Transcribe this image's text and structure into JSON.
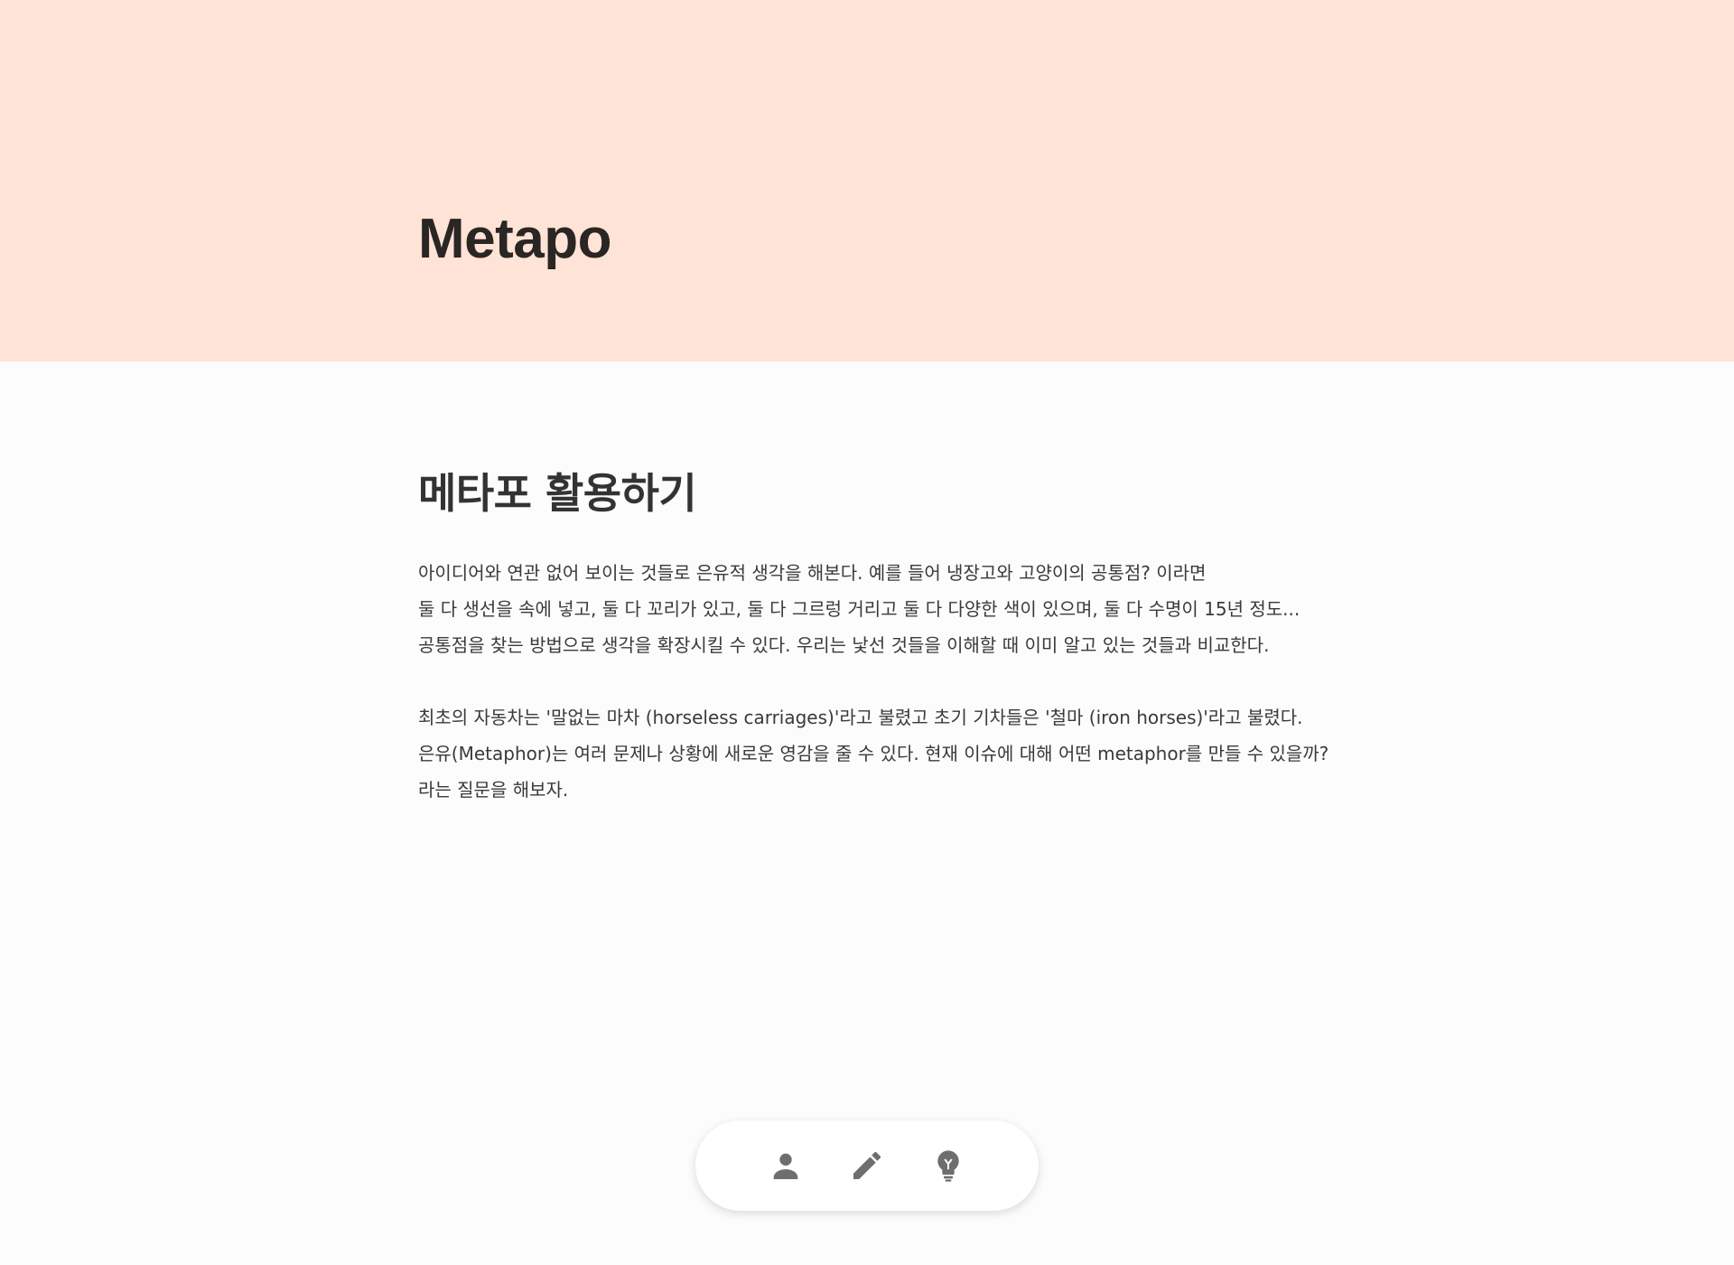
{
  "app": {
    "title": "Metapo"
  },
  "colors": {
    "hero_background": "#ffe3d6",
    "page_background": "#fcfcfc",
    "icon": "#6e6e6e"
  },
  "section": {
    "heading": "메타포 활용하기",
    "paragraphs": [
      {
        "lines": [
          "아이디어와 연관 없어 보이는 것들로 은유적 생각을 해본다. 예를 들어 냉장고와 고양이의 공통점? 이라면",
          "둘 다 생선을 속에 넣고, 둘 다 꼬리가 있고, 둘 다 그르렁 거리고 둘 다 다양한 색이 있으며, 둘 다 수명이 15년 정도...",
          "공통점을 찾는 방법으로 생각을 확장시킬 수 있다. 우리는 낯선 것들을 이해할 때 이미 알고 있는 것들과 비교한다."
        ]
      },
      {
        "lines": [
          "최초의 자동차는 '말없는 마차 (horseless carriages)'라고 불렸고 초기 기차들은 '철마 (iron horses)'라고 불렸다.",
          "은유(Metaphor)는 여러 문제나 상황에 새로운 영감을 줄 수 있다. 현재 이슈에 대해 어떤 metaphor를 만들 수 있을까?",
          "라는 질문을 해보자."
        ]
      }
    ]
  },
  "bottom_nav": {
    "items": [
      {
        "icon": "person-icon"
      },
      {
        "icon": "pencil-icon"
      },
      {
        "icon": "lightbulb-icon"
      }
    ]
  }
}
